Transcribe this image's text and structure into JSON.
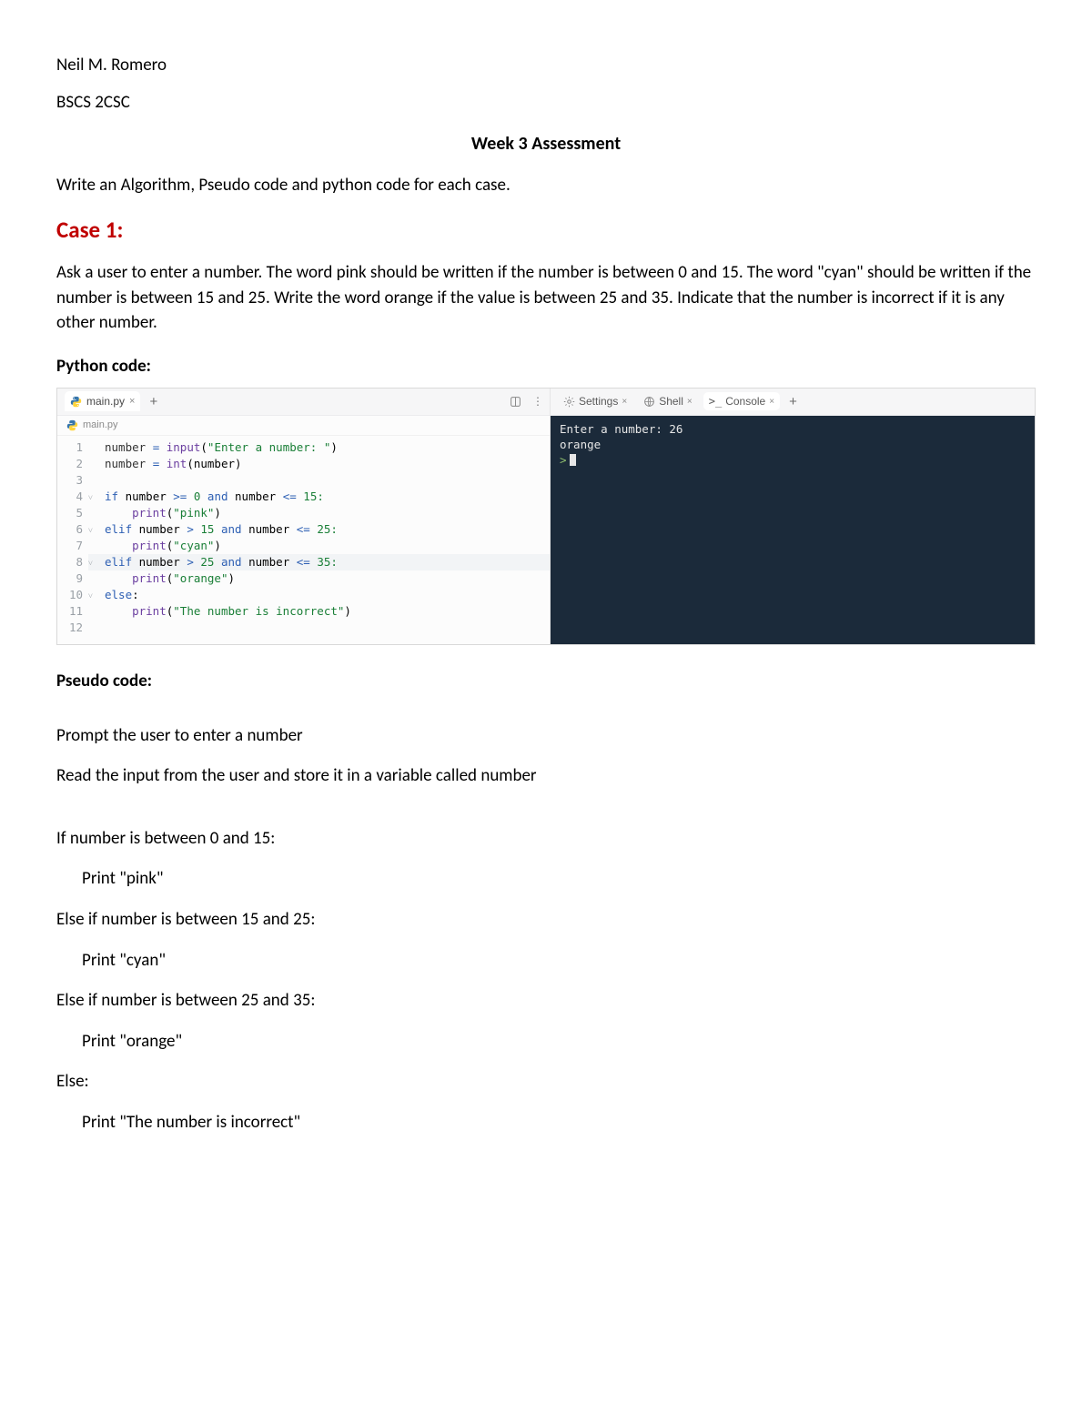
{
  "header": {
    "student_name": "Neil M. Romero",
    "student_class": "BSCS 2CSC",
    "title": "Week 3 Assessment",
    "instruction": "Write an Algorithm, Pseudo code and python code for each case."
  },
  "case1": {
    "heading": "Case 1:",
    "description": "Ask a user to enter a number. The word pink should be written if the number is between 0 and 15. The word \"cyan\" should be written if the number is between 15 and 25. Write the word orange if the value is between 25 and 35. Indicate that the number is incorrect if it is any other number.",
    "python_label": "Python code:",
    "pseudo_label": "Pseudo code:"
  },
  "ide": {
    "editor_tab": "main.py",
    "breadcrumb": "main.py",
    "tabs": {
      "settings": "Settings",
      "shell": "Shell",
      "console": "Console"
    },
    "code": {
      "l1_a": "number ",
      "l1_b": "= ",
      "l1_c": "input",
      "l1_d": "(",
      "l1_e": "\"Enter a number: \"",
      "l1_f": ")",
      "l2_a": "number ",
      "l2_b": "= ",
      "l2_c": "int",
      "l2_d": "(number)",
      "l4_a": "if",
      "l4_b": " number ",
      "l4_c": ">=",
      "l4_d": " 0 ",
      "l4_e": "and",
      "l4_f": " number ",
      "l4_g": "<=",
      "l4_h": " 15:",
      "l5_a": "    print",
      "l5_b": "(",
      "l5_c": "\"pink\"",
      "l5_d": ")",
      "l6_a": "elif",
      "l6_b": " number ",
      "l6_c": ">",
      "l6_d": " 15 ",
      "l6_e": "and",
      "l6_f": " number ",
      "l6_g": "<=",
      "l6_h": " 25:",
      "l7_a": "    print",
      "l7_b": "(",
      "l7_c": "\"cyan\"",
      "l7_d": ")",
      "l8_a": "elif",
      "l8_b": " number ",
      "l8_c": ">",
      "l8_d": " 25 ",
      "l8_e": "and",
      "l8_f": " number ",
      "l8_g": "<=",
      "l8_h": " 35:",
      "l9_a": "    print",
      "l9_b": "(",
      "l9_c": "\"orange\"",
      "l9_d": ")",
      "l10_a": "else",
      "l10_b": ":",
      "l11_a": "    print",
      "l11_b": "(",
      "l11_c": "\"The number is incorrect\"",
      "l11_d": ")"
    },
    "gutter": [
      "1",
      "2",
      "3",
      "4",
      "5",
      "6",
      "7",
      "8",
      "9",
      "10",
      "11",
      "12"
    ],
    "console": {
      "line1": "Enter a number: 26",
      "line2": "orange",
      "prompt": ">"
    }
  },
  "pseudo": {
    "p1": "Prompt the user to enter a number",
    "p2": "Read the input from the user and store it in a variable called number",
    "p3": "If number is between 0 and 15:",
    "p4": "Print \"pink\"",
    "p5": "Else if number is between 15 and 25:",
    "p6": "Print \"cyan\"",
    "p7": "Else if number is between 25 and 35:",
    "p8": "Print \"orange\"",
    "p9": "Else:",
    "p10": "Print \"The number is incorrect\""
  }
}
